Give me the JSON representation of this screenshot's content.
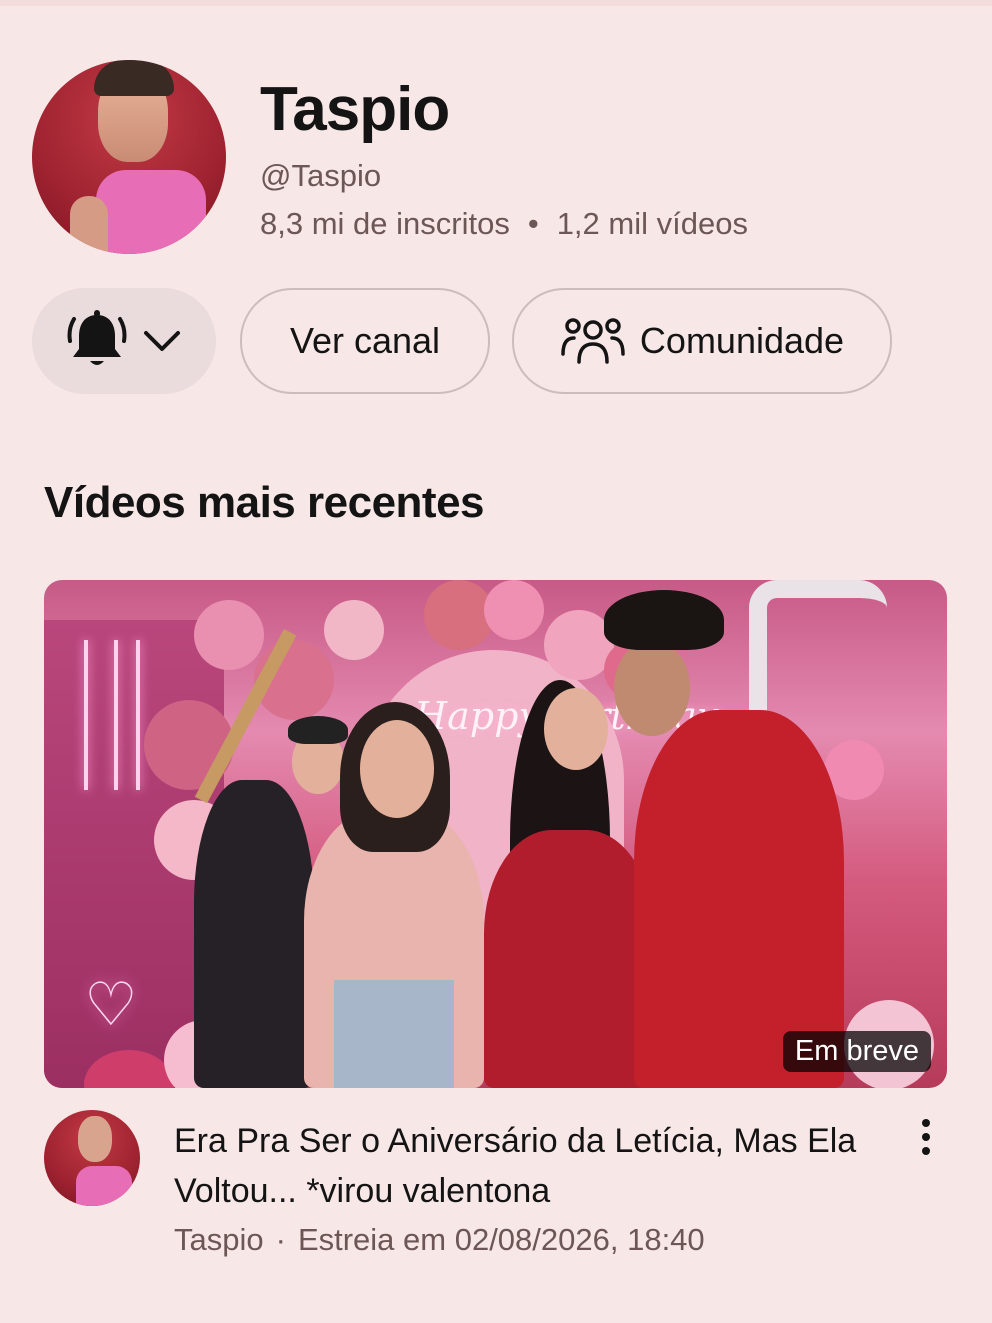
{
  "channel": {
    "name": "Taspio",
    "handle": "@Taspio",
    "subscribers": "8,3 mi de inscritos",
    "separator": "•",
    "videos": "1,2 mil vídeos"
  },
  "actions": {
    "bell_icon": "bell-icon",
    "chevron_icon": "chevron-down-icon",
    "view_channel": "Ver canal",
    "community_icon": "community-icon",
    "community": "Comunidade"
  },
  "section": {
    "title": "Vídeos mais recentes"
  },
  "video": {
    "thumbnail_text": "Happy Birthday",
    "badge": "Em breve",
    "title": "Era Pra Ser o Aniversário da Letícia, Mas Ela Voltou... *virou valentona",
    "channel": "Taspio",
    "separator": "·",
    "premiere": "Estreia em 02/08/2026, 18:40",
    "more_icon": "more-vertical-icon"
  },
  "colors": {
    "background": "#f8e7e7",
    "text_primary": "#141414",
    "text_secondary": "#6d5656"
  }
}
